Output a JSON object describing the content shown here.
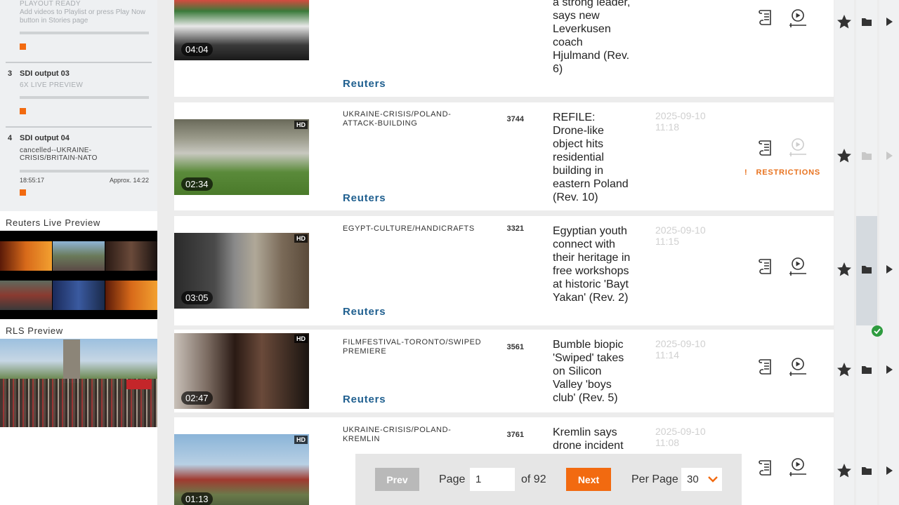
{
  "outputs": {
    "top": {
      "status": "PLAYOUT READY",
      "hint": "Add videos to Playlist or press Play Now button in Stories page"
    },
    "items": [
      {
        "num": "3",
        "name": "SDI output 03",
        "sub": "6X LIVE PREVIEW"
      },
      {
        "num": "4",
        "name": "SDI output 04",
        "sub": "cancelled--UKRAINE-CRISIS/BRITAIN-NATO",
        "time": "18:55:17",
        "approx": "Approx. 14:22"
      }
    ]
  },
  "previews": {
    "live_title": "Reuters Live Preview",
    "rls_title": "RLS Preview"
  },
  "rows": [
    {
      "duration": "04:04",
      "hd": "",
      "slug": "",
      "num": "",
      "source": "Reuters",
      "title": "a strong leader, says new Leverkusen coach Hjulmand (Rev. 6)",
      "date": "",
      "restriction": ""
    },
    {
      "duration": "02:34",
      "hd": "HD",
      "slug": "UKRAINE-CRISIS/POLAND-ATTACK-BUILDING",
      "num": "3744",
      "source": "Reuters",
      "title": "REFILE: Drone-like object hits residential building in eastern Poland (Rev. 10)",
      "date": "2025-09-10 11:18",
      "restriction": "RESTRICTIONS",
      "restriction_mark": "!"
    },
    {
      "duration": "03:05",
      "hd": "HD",
      "slug": "EGYPT-CULTURE/HANDICRAFTS",
      "num": "3321",
      "source": "Reuters",
      "title": "Egyptian youth connect with their heritage in free workshops at historic 'Bayt Yakan' (Rev. 2)",
      "date": "2025-09-10 11:15",
      "restriction": ""
    },
    {
      "duration": "02:47",
      "hd": "HD",
      "slug": "FILMFESTIVAL-TORONTO/SWIPED PREMIERE",
      "num": "3561",
      "source": "Reuters",
      "title": "Bumble biopic 'Swiped' takes on Silicon Valley 'boys club' (Rev. 5)",
      "date": "2025-09-10 11:14",
      "restriction": ""
    },
    {
      "duration": "01:13",
      "hd": "HD",
      "slug": "UKRAINE-CRISIS/POLAND-KREMLIN",
      "num": "3761",
      "source": "",
      "title": "Kremlin says drone incident",
      "date": "2025-09-10 11:08",
      "restriction": ""
    }
  ],
  "pagination": {
    "prev": "Prev",
    "page_label": "Page",
    "page_value": "1",
    "of_label": "of 92",
    "next": "Next",
    "per_page_label": "Per Page",
    "per_page_value": "30"
  },
  "colors": {
    "accent": "#f26a10",
    "link": "#1f5f8f",
    "restriction": "#e8721e"
  }
}
